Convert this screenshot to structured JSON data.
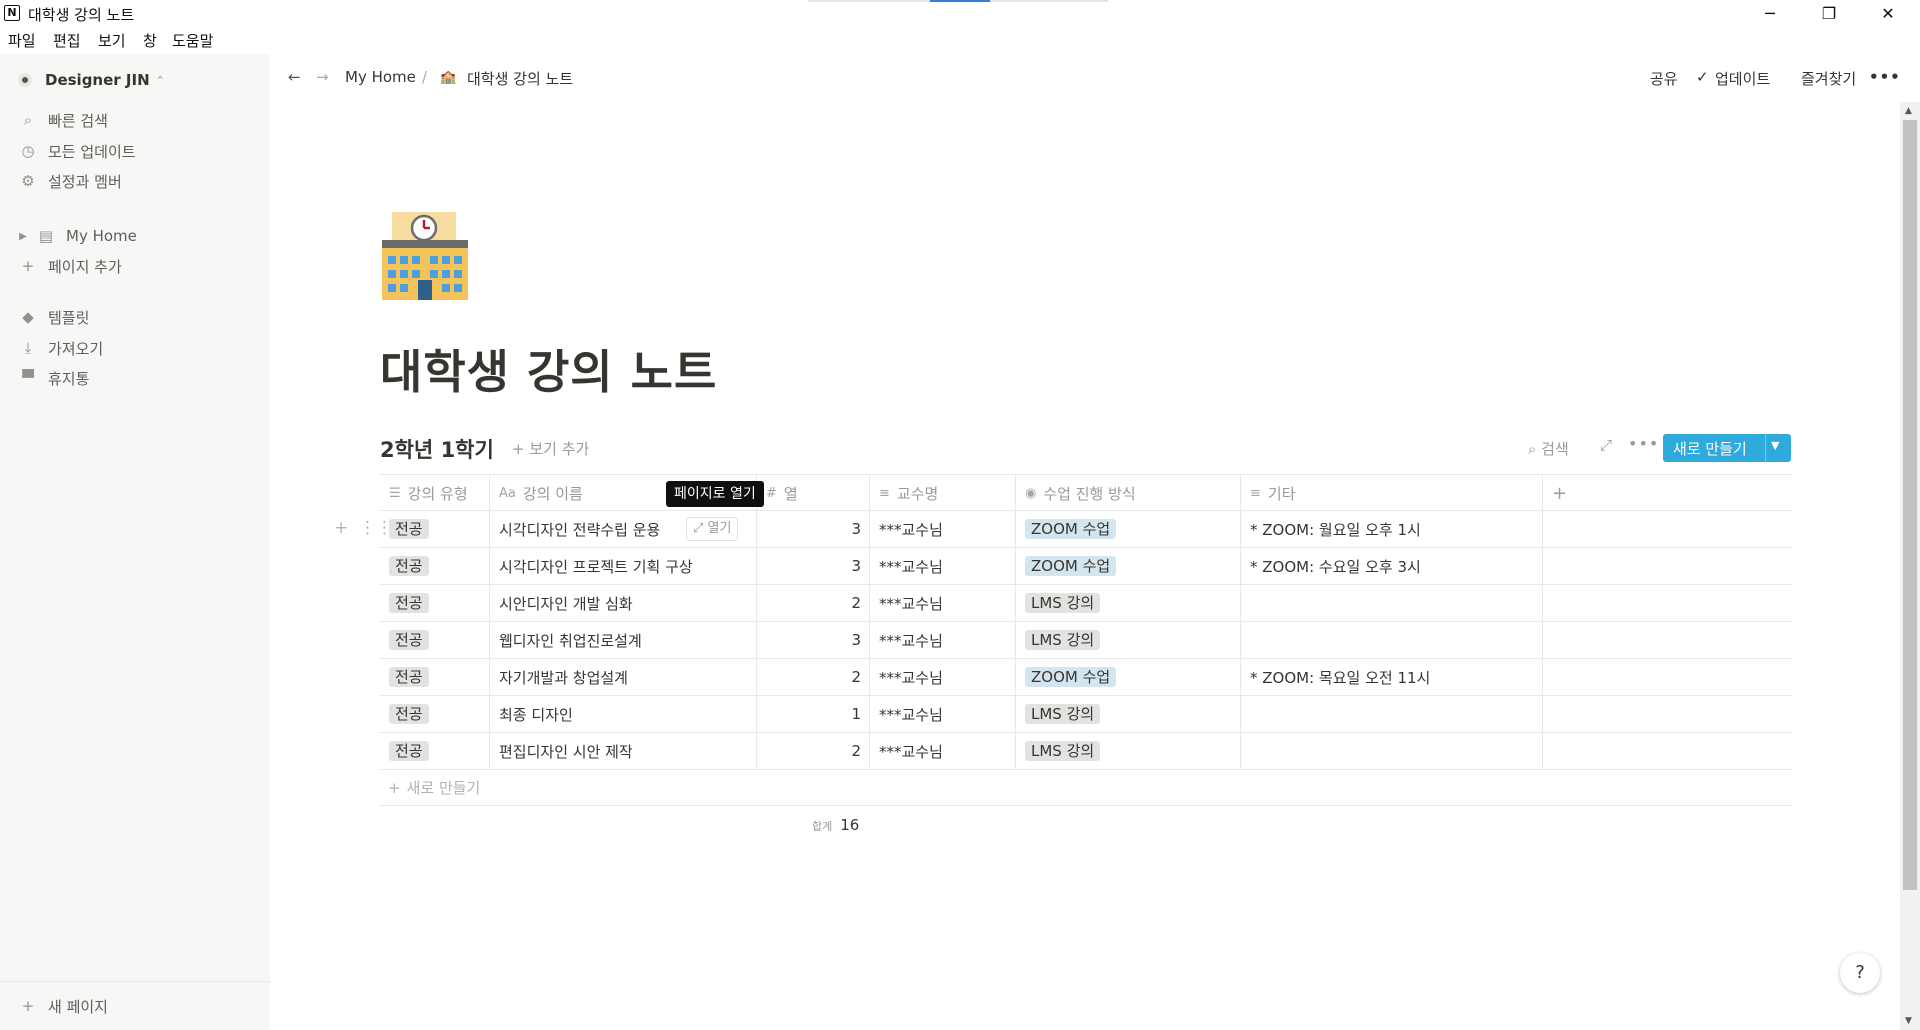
{
  "window": {
    "title": "대학생 강의 노트",
    "app_icon": "N"
  },
  "menu": [
    "파일",
    "편집",
    "보기",
    "창",
    "도움말"
  ],
  "sidebar": {
    "workspace": "Designer JIN",
    "top_items": [
      {
        "icon": "search-icon",
        "label": "빠른 검색"
      },
      {
        "icon": "clock-icon",
        "label": "모든 업데이트"
      },
      {
        "icon": "gear-icon",
        "label": "설정과 멤버"
      }
    ],
    "pages": [
      {
        "label": "My Home"
      }
    ],
    "add_page": "페이지 추가",
    "bottom_items": [
      {
        "icon": "shapes-icon",
        "label": "템플릿"
      },
      {
        "icon": "download-icon",
        "label": "가져오기"
      },
      {
        "icon": "trash-icon",
        "label": "휴지통"
      }
    ],
    "new_page": "새 페이지"
  },
  "topbar": {
    "breadcrumb": [
      "My Home",
      "/",
      "대학생 강의 노트"
    ],
    "share": "공유",
    "updates": "업데이트",
    "favorites": "즐겨찾기",
    "more": "•••"
  },
  "page": {
    "icon": "school-building-emoji",
    "title": "대학생 강의 노트"
  },
  "database": {
    "view_title": "2학년 1학기",
    "add_view": "보기 추가",
    "search": "검색",
    "new_button": "새로 만들기",
    "columns": [
      "강의 유형",
      "강의 이름",
      "열",
      "교수명",
      "수업 진행 방식",
      "기타"
    ],
    "rows": [
      {
        "type": "전공",
        "name": "시각디자인 전략수립 운용",
        "credits": "3",
        "professor": "***교수님",
        "method": "ZOOM 수업",
        "method_color": "blue",
        "note": "* ZOOM: 월요일 오후 1시"
      },
      {
        "type": "전공",
        "name": "시각디자인 프로젝트 기획 구상",
        "credits": "3",
        "professor": "***교수님",
        "method": "ZOOM 수업",
        "method_color": "blue",
        "note": "* ZOOM: 수요일 오후 3시"
      },
      {
        "type": "전공",
        "name": "시안디자인 개발 심화",
        "credits": "2",
        "professor": "***교수님",
        "method": "LMS 강의",
        "method_color": "gray",
        "note": ""
      },
      {
        "type": "전공",
        "name": "웹디자인 취업진로설계",
        "credits": "3",
        "professor": "***교수님",
        "method": "LMS 강의",
        "method_color": "gray",
        "note": ""
      },
      {
        "type": "전공",
        "name": "자기개발과 창업설계",
        "credits": "2",
        "professor": "***교수님",
        "method": "ZOOM 수업",
        "method_color": "blue",
        "note": "* ZOOM: 목요일 오전 11시"
      },
      {
        "type": "전공",
        "name": "최종 디자인",
        "credits": "1",
        "professor": "***교수님",
        "method": "LMS 강의",
        "method_color": "gray",
        "note": ""
      },
      {
        "type": "전공",
        "name": "편집디자인 시안 제작",
        "credits": "2",
        "professor": "***교수님",
        "method": "LMS 강의",
        "method_color": "gray",
        "note": ""
      }
    ],
    "open_button": "열기",
    "tooltip": "페이지로 열기",
    "new_row": "새로 만들기",
    "sum_label": "합계",
    "sum_value": "16"
  },
  "colors": {
    "accent": "#2eaadc",
    "tag_blue": "#d3e5ef",
    "tag_gray": "#e3e2e0"
  },
  "help": "?"
}
